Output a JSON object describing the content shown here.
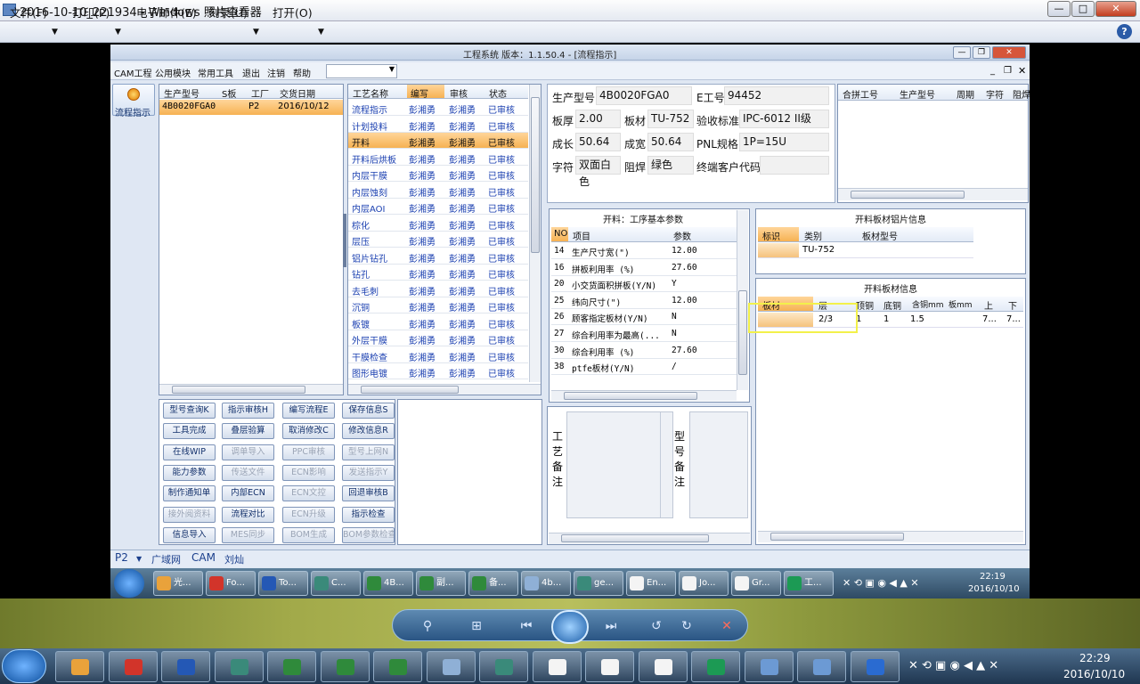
{
  "viewer": {
    "title": "2016-10-10_221934 - Windows 照片查看器",
    "menu": [
      "文件(F)",
      "打印(P)",
      "电子邮件(E)",
      "刻录(U)",
      "打开(O)"
    ],
    "help": "?",
    "min": "—",
    "max": "□",
    "close": "✕"
  },
  "app": {
    "title": "工程系统   版本：1.1.50.4 - [流程指示]",
    "menu": [
      "CAM工程",
      "公用模块",
      "常用工具",
      "退出",
      "注销",
      "帮助"
    ],
    "nav_label": "流程指示",
    "model_grid": {
      "headers": [
        "生产型号",
        "S板",
        "工厂",
        "交货日期"
      ],
      "rows": [
        [
          "4B0020FGA0",
          "",
          "P2",
          "2016/10/12"
        ]
      ]
    },
    "process_grid": {
      "headers": [
        "工艺名称",
        "编写",
        "审核",
        "状态"
      ],
      "rows": [
        [
          "流程指示",
          "彭湘勇",
          "彭湘勇",
          "已审核"
        ],
        [
          "计划投料",
          "彭湘勇",
          "彭湘勇",
          "已审核"
        ],
        [
          "开料",
          "彭湘勇",
          "彭湘勇",
          "已审核"
        ],
        [
          "开料后烘板",
          "彭湘勇",
          "彭湘勇",
          "已审核"
        ],
        [
          "内层干膜",
          "彭湘勇",
          "彭湘勇",
          "已审核"
        ],
        [
          "内层蚀刻",
          "彭湘勇",
          "彭湘勇",
          "已审核"
        ],
        [
          "内层AOI",
          "彭湘勇",
          "彭湘勇",
          "已审核"
        ],
        [
          "棕化",
          "彭湘勇",
          "彭湘勇",
          "已审核"
        ],
        [
          "层压",
          "彭湘勇",
          "彭湘勇",
          "已审核"
        ],
        [
          "铝片钻孔",
          "彭湘勇",
          "彭湘勇",
          "已审核"
        ],
        [
          "钻孔",
          "彭湘勇",
          "彭湘勇",
          "已审核"
        ],
        [
          "去毛刺",
          "彭湘勇",
          "彭湘勇",
          "已审核"
        ],
        [
          "沉铜",
          "彭湘勇",
          "彭湘勇",
          "已审核"
        ],
        [
          "板镀",
          "彭湘勇",
          "彭湘勇",
          "已审核"
        ],
        [
          "外层干膜",
          "彭湘勇",
          "彭湘勇",
          "已审核"
        ],
        [
          "干膜检查",
          "彭湘勇",
          "彭湘勇",
          "已审核"
        ],
        [
          "图形电镀",
          "彭湘勇",
          "彭湘勇",
          "已审核"
        ]
      ],
      "selected": 2
    },
    "info": {
      "f1l": "生产型号",
      "f1v": "4B0020FGA0",
      "f2l": "E工号",
      "f2v": "94452",
      "f3l": "板厚",
      "f3v": "2.00",
      "f4l": "板材",
      "f4v": "TU-752",
      "f5l": "验收标准",
      "f5v": "IPC-6012 II级",
      "f6l": "成长",
      "f6v": "50.64",
      "f7l": "成宽",
      "f7v": "50.64",
      "f8l": "PNL规格",
      "f8v": "1P=15U",
      "f9l": "字符",
      "f9v": "双面白色",
      "f10l": "阻焊",
      "f10v": "绿色",
      "f11l": "终端客户代码",
      "f11v": ""
    },
    "merge_grid": {
      "headers": [
        "合拼工号",
        "生产型号",
        "周期",
        "字符",
        "阻焊"
      ]
    },
    "params": {
      "title": "开料：工序基本参数",
      "headers": [
        "NO",
        "项目",
        "参数"
      ],
      "rows": [
        [
          "14",
          "生产尺寸宽(\")",
          "12.00"
        ],
        [
          "16",
          "拼板利用率 (%)",
          "27.60"
        ],
        [
          "20",
          "小交货面积拼板(Y/N)",
          "Y"
        ],
        [
          "25",
          "纬向尺寸(\")",
          "12.00"
        ],
        [
          "26",
          "顾客指定板材(Y/N)",
          "N"
        ],
        [
          "27",
          "综合利用率为最高(...",
          "N"
        ],
        [
          "30",
          "综合利用率 (%)",
          "27.60"
        ],
        [
          "38",
          "ptfe板材(Y/N)",
          "/"
        ]
      ]
    },
    "alu": {
      "title": "开料板材铝片信息",
      "headers": [
        "标识",
        "类别",
        "板材型号"
      ],
      "rows": [
        [
          "",
          "TU-752",
          ""
        ]
      ]
    },
    "board": {
      "title": "开料板材信息",
      "headers": [
        "板材",
        "层",
        "顶铜",
        "底铜",
        "含铜mm",
        "板mm",
        "上",
        "下"
      ],
      "rows": [
        [
          "",
          "2/3",
          "1",
          "1",
          "1.5",
          "",
          "7...",
          "7..."
        ]
      ]
    },
    "buttons": [
      [
        "型号查询K",
        false
      ],
      [
        "指示审核H",
        false
      ],
      [
        "编写流程E",
        false
      ],
      [
        "保存信息S",
        false
      ],
      [
        "工具完成",
        false
      ],
      [
        "叠层验算",
        false
      ],
      [
        "取消修改C",
        false
      ],
      [
        "修改信息R",
        false
      ],
      [
        "在线WIP",
        false
      ],
      [
        "调单导入",
        true
      ],
      [
        "PPC审核",
        true
      ],
      [
        "型号上网N",
        true
      ],
      [
        "能力参数",
        false
      ],
      [
        "传送文件",
        true
      ],
      [
        "ECN影响",
        true
      ],
      [
        "发送指示Y",
        true
      ],
      [
        "制作通知单",
        false
      ],
      [
        "内部ECN",
        false
      ],
      [
        "ECN文控",
        true
      ],
      [
        "回退审核B",
        false
      ],
      [
        "接外阅资料",
        true
      ],
      [
        "流程对比",
        false
      ],
      [
        "ECN升级",
        true
      ],
      [
        "指示检查",
        false
      ],
      [
        "信息导入",
        false
      ],
      [
        "MES同步",
        true
      ],
      [
        "BOM生成",
        true
      ],
      [
        "BOM参数检查",
        true
      ]
    ],
    "notes": {
      "left": "工艺备注",
      "right": "型号备注"
    },
    "status": [
      "P2",
      "广域网",
      "CAM",
      "刘灿"
    ],
    "taskbar": {
      "items": [
        "光...",
        "Fo...",
        "To...",
        "C...",
        "4B...",
        "副...",
        "备...",
        "4b...",
        "ge...",
        "En...",
        "Jo...",
        "Gr...",
        "工..."
      ],
      "time": "22:19",
      "date": "2016/10/10"
    }
  },
  "system_taskbar": {
    "time": "22:29",
    "date": "2016/10/10"
  }
}
